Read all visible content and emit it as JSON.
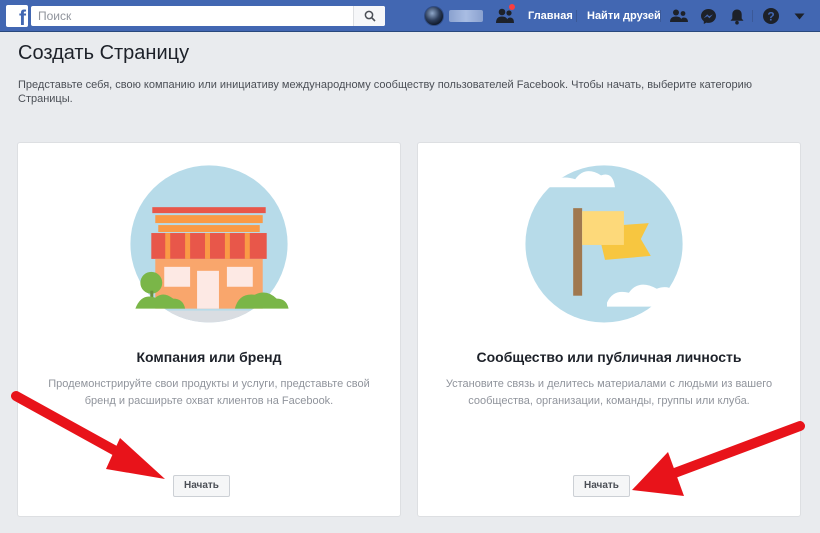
{
  "topbar": {
    "search_placeholder": "Поиск",
    "nav": {
      "home": "Главная",
      "find_friends": "Найти друзей"
    }
  },
  "page": {
    "title": "Создать Страницу",
    "description": "Представьте себя, свою компанию или инициативу международному сообществу пользователей Facebook. Чтобы начать, выберите категорию Страницы."
  },
  "cards": [
    {
      "title": "Компания или бренд",
      "description": "Продемонстрируйте свои продукты и услуги, представьте свой бренд и расширьте охват клиентов на Facebook.",
      "button": "Начать"
    },
    {
      "title": "Сообщество или публичная личность",
      "description": "Установите связь и делитесь материалами с людьми из вашего сообщества, организации, команды, группы или клуба.",
      "button": "Начать"
    }
  ],
  "colors": {
    "brand_blue": "#4267b2",
    "annotation_arrow": "#e8131a",
    "illustration_circle": "#b7dbe9",
    "store_roof": "#e8574a",
    "flag_yellow": "#fbd66e"
  }
}
